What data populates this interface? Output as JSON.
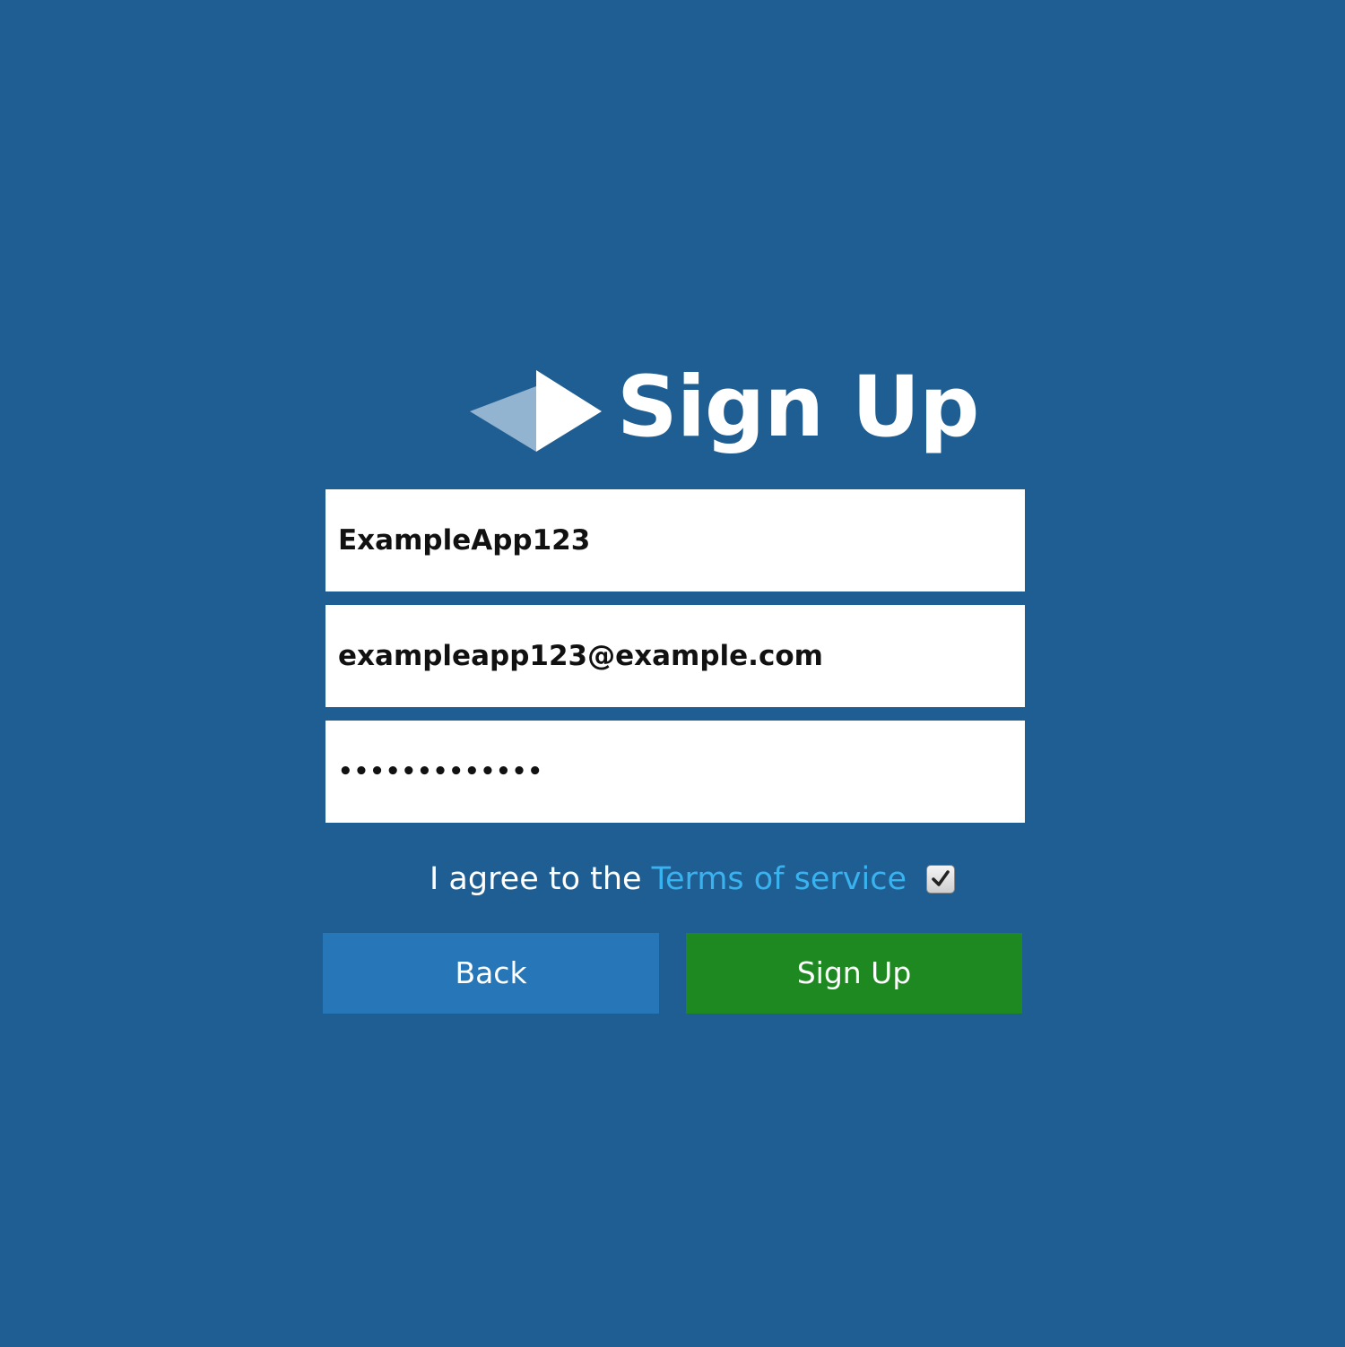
{
  "header": {
    "logo_icon": "play-arrow-logo-icon",
    "title": "Sign Up"
  },
  "form": {
    "username": {
      "value": "ExampleApp123"
    },
    "email": {
      "value": "exampleapp123@example.com"
    },
    "password": {
      "value": "•••••••••••••"
    },
    "terms": {
      "prefix": "I agree to the",
      "link_label": "Terms of service",
      "checked": true,
      "checkbox_icon": "checkmark-icon"
    }
  },
  "actions": {
    "back_label": "Back",
    "signup_label": "Sign Up"
  },
  "colors": {
    "background": "#1f5e92",
    "back_button": "#2676b8",
    "signup_button": "#1f8921",
    "link": "#38b3f0"
  }
}
